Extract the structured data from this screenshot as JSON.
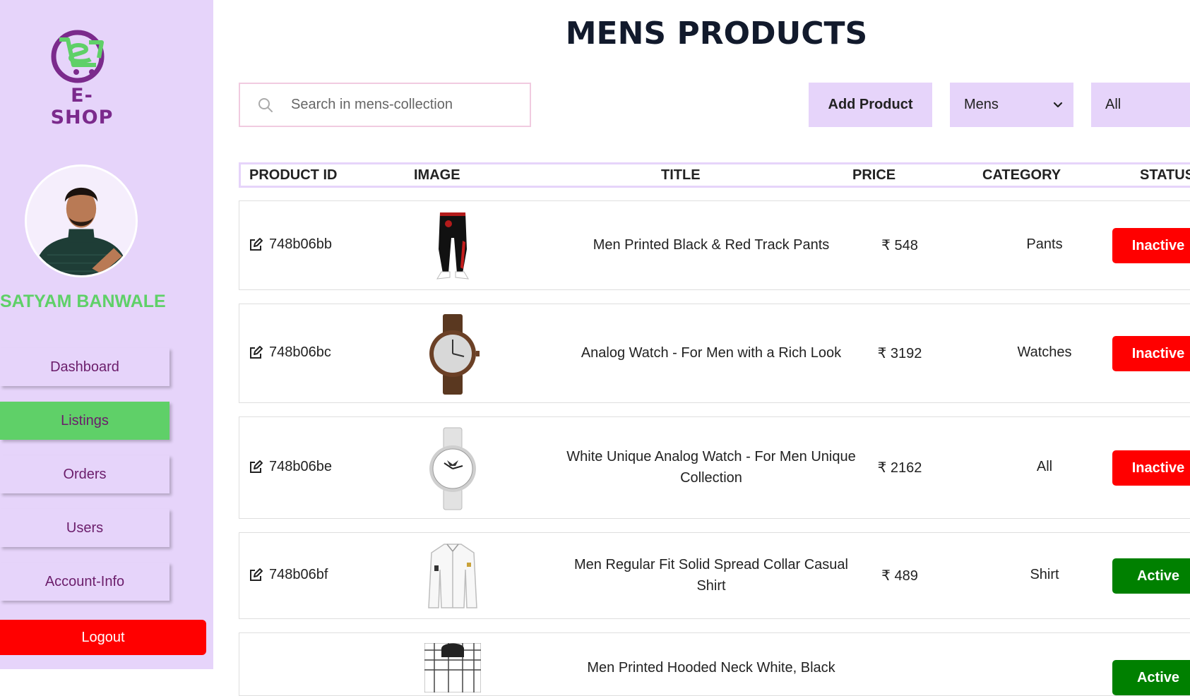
{
  "brand": {
    "name": "E-SHOP",
    "colors": {
      "purple": "#7b2a8c",
      "green": "#5fd068"
    }
  },
  "user": {
    "name": "SATYAM BANWALE"
  },
  "nav": {
    "items": [
      {
        "label": "Dashboard",
        "active": false
      },
      {
        "label": "Listings",
        "active": true
      },
      {
        "label": "Orders",
        "active": false
      },
      {
        "label": "Users",
        "active": false
      },
      {
        "label": "Account-Info",
        "active": false
      }
    ],
    "logout_label": "Logout"
  },
  "page": {
    "title": "MENS PRODUCTS"
  },
  "toolbar": {
    "search_placeholder": "Search in mens-collection",
    "add_label": "Add Product",
    "category_selected": "Mens",
    "status_selected": "All"
  },
  "table": {
    "headers": [
      "PRODUCT ID",
      "IMAGE",
      "TITLE",
      "PRICE",
      "CATEGORY",
      "STATUS"
    ],
    "rows": [
      {
        "id": "748b06bb",
        "image": "track-pants",
        "title": "Men Printed Black & Red Track Pants",
        "price": "₹ 548",
        "category": "Pants",
        "status": "Inactive"
      },
      {
        "id": "748b06bc",
        "image": "brown-watch",
        "title": "Analog Watch - For Men with a Rich Look",
        "price": "₹ 3192",
        "category": "Watches",
        "status": "Inactive"
      },
      {
        "id": "748b06be",
        "image": "white-watch",
        "title": "White Unique Analog Watch - For Men Unique Collection",
        "price": "₹ 2162",
        "category": "All",
        "status": "Inactive"
      },
      {
        "id": "748b06bf",
        "image": "white-shirt",
        "title": "Men Regular Fit Solid Spread Collar Casual Shirt",
        "price": "₹ 489",
        "category": "Shirt",
        "status": "Active"
      },
      {
        "image": "hooded-shirt",
        "title": "Men Printed Hooded Neck White, Black",
        "status": "Active"
      }
    ]
  }
}
